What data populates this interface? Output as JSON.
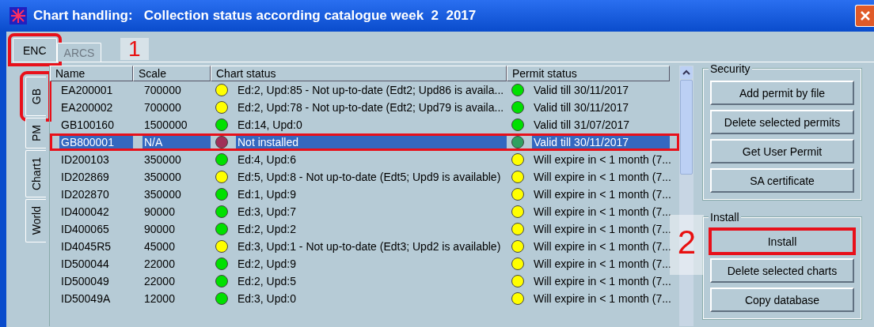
{
  "window": {
    "title": "Chart handling:   Collection status according catalogue week  2  2017"
  },
  "tabs": [
    {
      "label": "ENC",
      "selected": true,
      "disabled": false,
      "highlighted": true,
      "callout": "1"
    },
    {
      "label": "ARCS",
      "selected": false,
      "disabled": true,
      "highlighted": false
    }
  ],
  "side_tabs": [
    {
      "label": "GB",
      "selected": true,
      "highlighted": true
    },
    {
      "label": "PM",
      "selected": false,
      "highlighted": false
    },
    {
      "label": "Chart1",
      "selected": false,
      "highlighted": false
    },
    {
      "label": "World",
      "selected": false,
      "highlighted": false
    }
  ],
  "table": {
    "columns": [
      "Name",
      "Scale",
      "Chart status",
      "Permit status"
    ],
    "rows": [
      {
        "name": "EA200001",
        "scale": "700000",
        "chart_status": {
          "text": "Ed:2, Upd:85 - Not up-to-date (Edt2; Upd86 is availa...",
          "color": "#ffff00"
        },
        "permit_status": {
          "text": "Valid till 30/11/2017",
          "color": "#00e000"
        },
        "selected": false
      },
      {
        "name": "EA200002",
        "scale": "700000",
        "chart_status": {
          "text": "Ed:2, Upd:78 - Not up-to-date (Edt2; Upd79 is availa...",
          "color": "#ffff00"
        },
        "permit_status": {
          "text": "Valid till 30/11/2017",
          "color": "#00e000"
        },
        "selected": false
      },
      {
        "name": "GB100160",
        "scale": "1500000",
        "chart_status": {
          "text": "Ed:14, Upd:0",
          "color": "#00e000"
        },
        "permit_status": {
          "text": "Valid till 31/07/2017",
          "color": "#00e000"
        },
        "selected": false
      },
      {
        "name": "GB800001",
        "scale": "N/A",
        "chart_status": {
          "text": "Not installed",
          "color": "#a03058"
        },
        "permit_status": {
          "text": "Valid till 30/11/2017",
          "color": "#30a060"
        },
        "selected": true,
        "highlighted": true
      },
      {
        "name": "ID200103",
        "scale": "350000",
        "chart_status": {
          "text": "Ed:4, Upd:6",
          "color": "#00e000"
        },
        "permit_status": {
          "text": "Will expire in < 1 month (7...",
          "color": "#ffff00"
        },
        "selected": false
      },
      {
        "name": "ID202869",
        "scale": "350000",
        "chart_status": {
          "text": "Ed:5, Upd:8 - Not up-to-date (Edt5; Upd9 is available)",
          "color": "#ffff00"
        },
        "permit_status": {
          "text": "Will expire in < 1 month (7...",
          "color": "#ffff00"
        },
        "selected": false
      },
      {
        "name": "ID202870",
        "scale": "350000",
        "chart_status": {
          "text": "Ed:1, Upd:9",
          "color": "#00e000"
        },
        "permit_status": {
          "text": "Will expire in < 1 month (7...",
          "color": "#ffff00"
        },
        "selected": false
      },
      {
        "name": "ID400042",
        "scale": "90000",
        "chart_status": {
          "text": "Ed:3, Upd:7",
          "color": "#00e000"
        },
        "permit_status": {
          "text": "Will expire in < 1 month (7...",
          "color": "#ffff00"
        },
        "selected": false
      },
      {
        "name": "ID400065",
        "scale": "90000",
        "chart_status": {
          "text": "Ed:2, Upd:2",
          "color": "#00e000"
        },
        "permit_status": {
          "text": "Will expire in < 1 month (7...",
          "color": "#ffff00"
        },
        "selected": false
      },
      {
        "name": "ID4045R5",
        "scale": "45000",
        "chart_status": {
          "text": "Ed:3, Upd:1 - Not up-to-date (Edt3; Upd2 is available)",
          "color": "#ffff00"
        },
        "permit_status": {
          "text": "Will expire in < 1 month (7...",
          "color": "#ffff00"
        },
        "selected": false
      },
      {
        "name": "ID500044",
        "scale": "22000",
        "chart_status": {
          "text": "Ed:2, Upd:9",
          "color": "#00e000"
        },
        "permit_status": {
          "text": "Will expire in < 1 month (7...",
          "color": "#ffff00"
        },
        "selected": false
      },
      {
        "name": "ID500049",
        "scale": "22000",
        "chart_status": {
          "text": "Ed:2, Upd:5",
          "color": "#00e000"
        },
        "permit_status": {
          "text": "Will expire in < 1 month (7...",
          "color": "#ffff00"
        },
        "selected": false
      },
      {
        "name": "ID50049A",
        "scale": "12000",
        "chart_status": {
          "text": "Ed:3, Upd:0",
          "color": "#00e000"
        },
        "permit_status": {
          "text": "Will expire in < 1 month (7...",
          "color": "#ffff00"
        },
        "selected": false
      }
    ]
  },
  "groups": [
    {
      "title": "Security",
      "buttons": [
        {
          "label": "Add permit by file",
          "highlighted": false
        },
        {
          "label": "Delete selected permits",
          "highlighted": false
        },
        {
          "label": "Get User Permit",
          "highlighted": false
        },
        {
          "label": "SA certificate",
          "highlighted": false
        }
      ]
    },
    {
      "title": "Install",
      "buttons": [
        {
          "label": "Install",
          "highlighted": true,
          "callout": "2"
        },
        {
          "label": "Delete selected charts",
          "highlighted": false
        },
        {
          "label": "Copy database",
          "highlighted": false
        }
      ]
    }
  ]
}
